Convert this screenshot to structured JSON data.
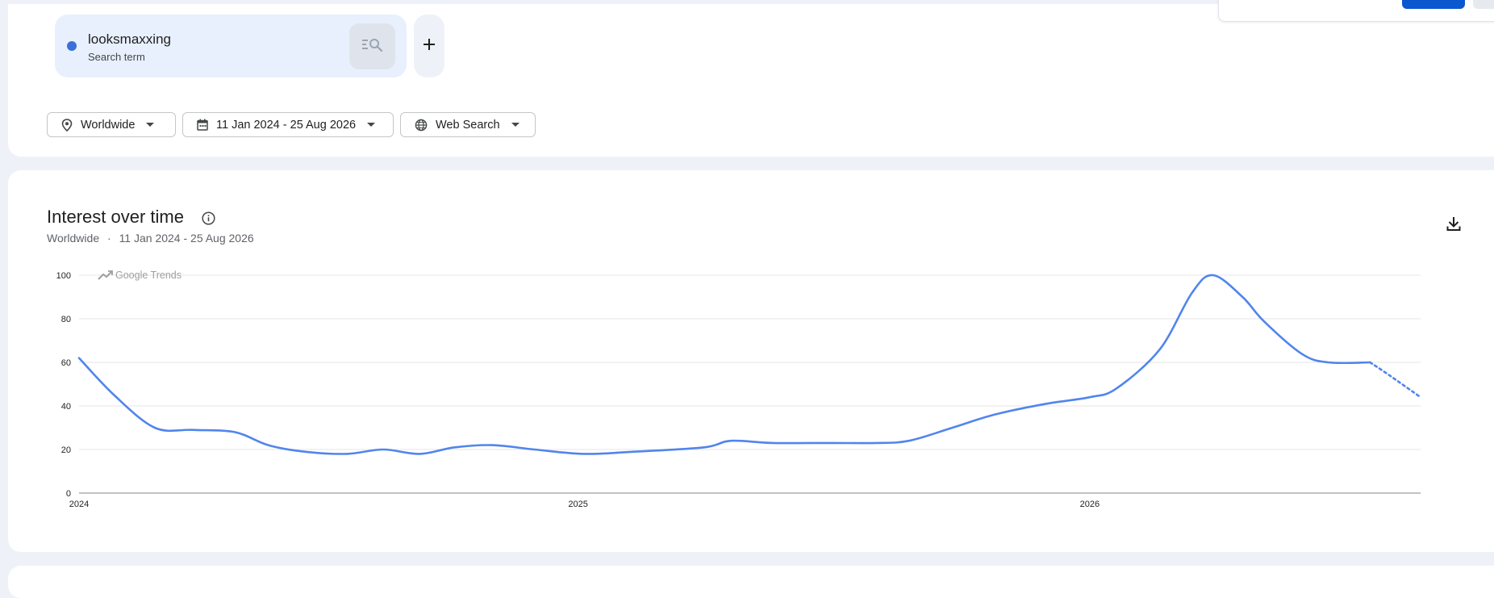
{
  "search_term": {
    "name": "looksmaxxing",
    "type": "Search term",
    "color": "#3a6fd8"
  },
  "filters": {
    "location": "Worldwide",
    "date_range": "11 Jan 2024 - 25 Aug 2026",
    "property": "Web Search"
  },
  "chart_section": {
    "title": "Interest over time",
    "subtitle_location": "Worldwide",
    "subtitle_separator": "·",
    "subtitle_range": "11 Jan 2024 - 25 Aug 2026",
    "watermark": "Google Trends"
  },
  "icons": {
    "add": "plus-icon",
    "compare": "search-compare-icon",
    "location": "location-pin-icon",
    "calendar": "calendar-icon",
    "globe": "globe-icon",
    "info": "info-icon",
    "download": "download-icon"
  },
  "chart_data": {
    "type": "line",
    "title": "",
    "xlabel": "",
    "ylabel": "",
    "ylim": [
      0,
      100
    ],
    "yticks": [
      0,
      20,
      40,
      60,
      80,
      100
    ],
    "xticks": [
      {
        "value": "2024-01-11",
        "label": "2024"
      },
      {
        "value": "2025-01-01",
        "label": "2025"
      },
      {
        "value": "2026-01-01",
        "label": "2026"
      }
    ],
    "xlim": [
      "2024-01-11",
      "2026-08-25"
    ],
    "grid": true,
    "color": "#5185ec",
    "series": [
      {
        "name": "looksmaxxing",
        "points": [
          [
            "2024-01-11",
            62
          ],
          [
            "2024-02-05",
            45
          ],
          [
            "2024-03-05",
            30
          ],
          [
            "2024-04-01",
            29
          ],
          [
            "2024-05-01",
            28
          ],
          [
            "2024-05-25",
            22
          ],
          [
            "2024-06-20",
            19
          ],
          [
            "2024-07-20",
            18
          ],
          [
            "2024-08-15",
            20
          ],
          [
            "2024-09-10",
            18
          ],
          [
            "2024-10-05",
            21
          ],
          [
            "2024-11-01",
            22
          ],
          [
            "2024-12-01",
            20
          ],
          [
            "2025-01-05",
            18
          ],
          [
            "2025-02-10",
            19
          ],
          [
            "2025-04-01",
            21
          ],
          [
            "2025-04-20",
            24
          ],
          [
            "2025-05-20",
            23
          ],
          [
            "2025-07-01",
            23
          ],
          [
            "2025-08-01",
            23
          ],
          [
            "2025-08-25",
            24
          ],
          [
            "2025-09-25",
            30
          ],
          [
            "2025-10-25",
            36
          ],
          [
            "2025-12-01",
            41
          ],
          [
            "2026-01-01",
            44
          ],
          [
            "2026-01-20",
            48
          ],
          [
            "2026-02-20",
            66
          ],
          [
            "2026-03-15",
            92
          ],
          [
            "2026-03-30",
            100
          ],
          [
            "2026-04-20",
            90
          ],
          [
            "2026-05-05",
            79
          ],
          [
            "2026-06-01",
            64
          ],
          [
            "2026-06-20",
            60
          ],
          [
            "2026-07-20",
            60
          ]
        ],
        "partial": [
          [
            "2026-07-20",
            60
          ],
          [
            "2026-08-25",
            44
          ]
        ]
      }
    ]
  }
}
